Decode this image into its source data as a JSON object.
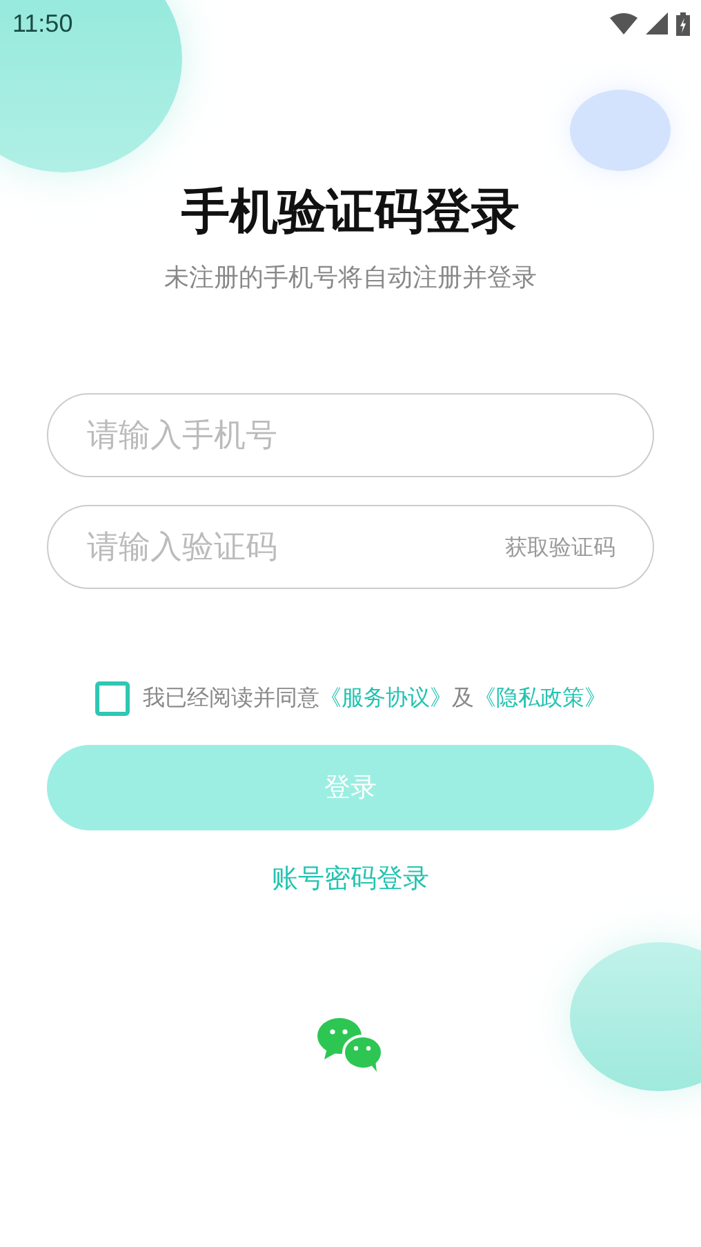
{
  "status_bar": {
    "time": "11:50"
  },
  "title": "手机验证码登录",
  "subtitle": "未注册的手机号将自动注册并登录",
  "phone_field": {
    "placeholder": "请输入手机号"
  },
  "code_field": {
    "placeholder": "请输入验证码",
    "action": "获取验证码"
  },
  "agreement": {
    "checked": false,
    "prefix": "我已经阅读并同意",
    "link_1": "《服务协议》",
    "joiner": "及",
    "link_2": "《隐私政策》"
  },
  "login_button": {
    "label": "登录",
    "disabled": true
  },
  "password_login_link": "账号密码登录"
}
